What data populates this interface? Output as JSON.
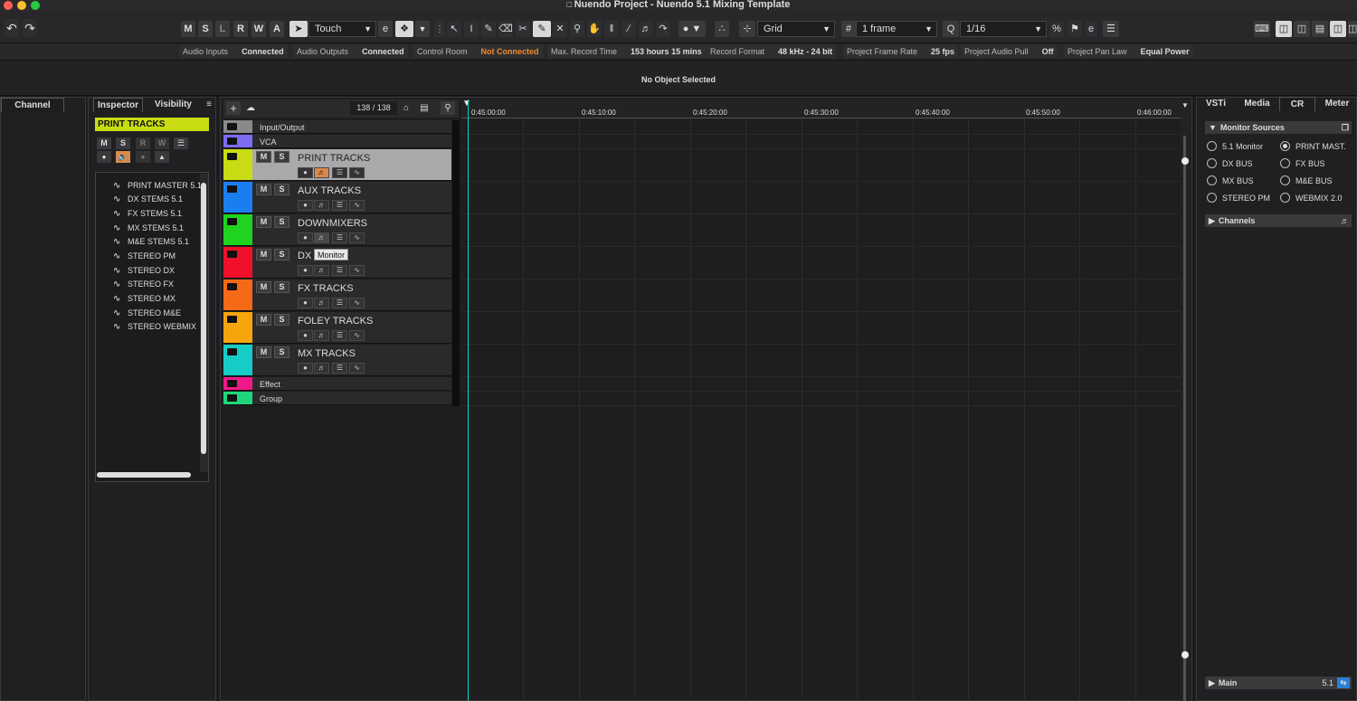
{
  "window": {
    "title": "Nuendo Project - Nuendo 5.1  Mixing Template",
    "traffic_colors": [
      "#ff5f57",
      "#febc2e",
      "#28c840"
    ]
  },
  "toolbar": {
    "msl": [
      "M",
      "S",
      "L",
      "R",
      "W",
      "A"
    ],
    "automation_mode": "Touch",
    "snap_type": "Grid",
    "grid_value": "1 frame",
    "quantize": "1/16"
  },
  "status": [
    {
      "label": "Audio Inputs",
      "value": "Connected"
    },
    {
      "label": "Audio Outputs",
      "value": "Connected"
    },
    {
      "label": "Control Room",
      "value": "Not Connected"
    },
    {
      "label": "Max. Record Time",
      "value": "153 hours 15 mins"
    },
    {
      "label": "Record Format",
      "value": "48 kHz - 24 bit"
    },
    {
      "label": "Project Frame Rate",
      "value": "25 fps"
    },
    {
      "label": "Project Audio Pull",
      "value": "Off"
    },
    {
      "label": "Project Pan Law",
      "value": "Equal Power"
    }
  ],
  "status_colors": {
    "warning": "#f08a24"
  },
  "info": {
    "message": "No Object Selected"
  },
  "left": {
    "channel_tab": "Channel",
    "inspector_tab": "Inspector",
    "visibility_tab": "Visibility",
    "selected_track": "PRINT TRACKS",
    "selected_color": "#c9dc13",
    "buttons": [
      "M",
      "S",
      "R",
      "W"
    ],
    "stems": [
      "PRINT MASTER 5.1",
      "DX STEMS 5.1",
      "FX STEMS 5.1",
      "MX STEMS 5.1",
      "M&E STEMS 5.1",
      "STEREO PM",
      "STEREO DX",
      "STEREO FX",
      "STEREO MX",
      "STEREO M&E",
      "STEREO WEBMIX"
    ]
  },
  "project": {
    "track_count": "138 / 138",
    "tooltip": "Monitor",
    "tracks": [
      {
        "name": "Input/Output",
        "color": "#8a8a8a",
        "small": true
      },
      {
        "name": "VCA",
        "color": "#7b6cf0",
        "small": true
      },
      {
        "name": "PRINT TRACKS",
        "color": "#c9dc13",
        "selected": true
      },
      {
        "name": "AUX TRACKS",
        "color": "#1b7ef0"
      },
      {
        "name": "DOWNMIXERS",
        "color": "#1fd31f"
      },
      {
        "name": "DX TRACKS",
        "color": "#f0102a"
      },
      {
        "name": "FX TRACKS",
        "color": "#f56a16"
      },
      {
        "name": "FOLEY TRACKS",
        "color": "#f6a50c"
      },
      {
        "name": "MX TRACKS",
        "color": "#16ccc6"
      },
      {
        "name": "Effect",
        "color": "#f0198a",
        "small": true
      },
      {
        "name": "Group",
        "color": "#1fd67c",
        "small": true
      }
    ],
    "ruler": [
      "0:45:00:00",
      "0:45:10:00",
      "0:45:20:00",
      "0:45:30:00",
      "0:45:40:00",
      "0:45:50:00",
      "0:46:00:00"
    ]
  },
  "right": {
    "tabs": [
      "VSTi",
      "Media",
      "CR",
      "Meter"
    ],
    "monitor_sources": "Monitor Sources",
    "sources": [
      {
        "label": "5.1 Monitor",
        "on": false
      },
      {
        "label": "PRINT MAST.",
        "on": true
      },
      {
        "label": "DX BUS",
        "on": false
      },
      {
        "label": "FX BUS",
        "on": false
      },
      {
        "label": "MX BUS",
        "on": false
      },
      {
        "label": "M&E BUS",
        "on": false
      },
      {
        "label": "STEREO PM",
        "on": false
      },
      {
        "label": "WEBMIX 2.0",
        "on": false
      }
    ],
    "channels": "Channels",
    "main": "Main",
    "main_format": "5.1"
  }
}
